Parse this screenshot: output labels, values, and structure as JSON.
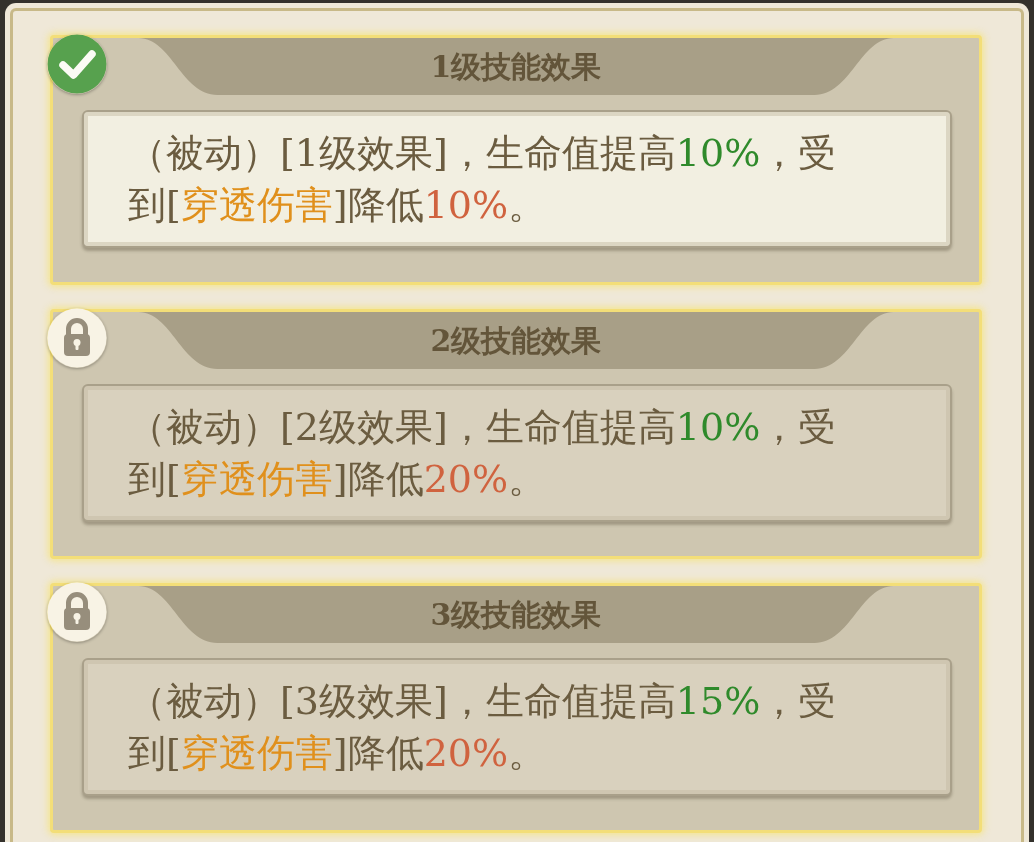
{
  "skill_levels": [
    {
      "title": "1级技能效果",
      "unlocked": true,
      "description": [
        {
          "kind": "plain",
          "text": "（被动）[1级效果]，生命值提高"
        },
        {
          "kind": "increase",
          "text": "10%"
        },
        {
          "kind": "plain",
          "text": "，受到["
        },
        {
          "kind": "keyword",
          "text": "穿透伤害"
        },
        {
          "kind": "plain",
          "text": "]降低"
        },
        {
          "kind": "decrease",
          "text": "10%"
        },
        {
          "kind": "plain",
          "text": "。"
        }
      ]
    },
    {
      "title": "2级技能效果",
      "unlocked": false,
      "description": [
        {
          "kind": "plain",
          "text": "（被动）[2级效果]，生命值提高"
        },
        {
          "kind": "increase",
          "text": "10%"
        },
        {
          "kind": "plain",
          "text": "，受到["
        },
        {
          "kind": "keyword",
          "text": "穿透伤害"
        },
        {
          "kind": "plain",
          "text": "]降低"
        },
        {
          "kind": "decrease",
          "text": "20%"
        },
        {
          "kind": "plain",
          "text": "。"
        }
      ]
    },
    {
      "title": "3级技能效果",
      "unlocked": false,
      "description": [
        {
          "kind": "plain",
          "text": "（被动）[3级效果]，生命值提高"
        },
        {
          "kind": "increase",
          "text": "15%"
        },
        {
          "kind": "plain",
          "text": "，受到["
        },
        {
          "kind": "keyword",
          "text": "穿透伤害"
        },
        {
          "kind": "plain",
          "text": "]降低"
        },
        {
          "kind": "decrease",
          "text": "20%"
        },
        {
          "kind": "plain",
          "text": "。"
        }
      ]
    }
  ]
}
